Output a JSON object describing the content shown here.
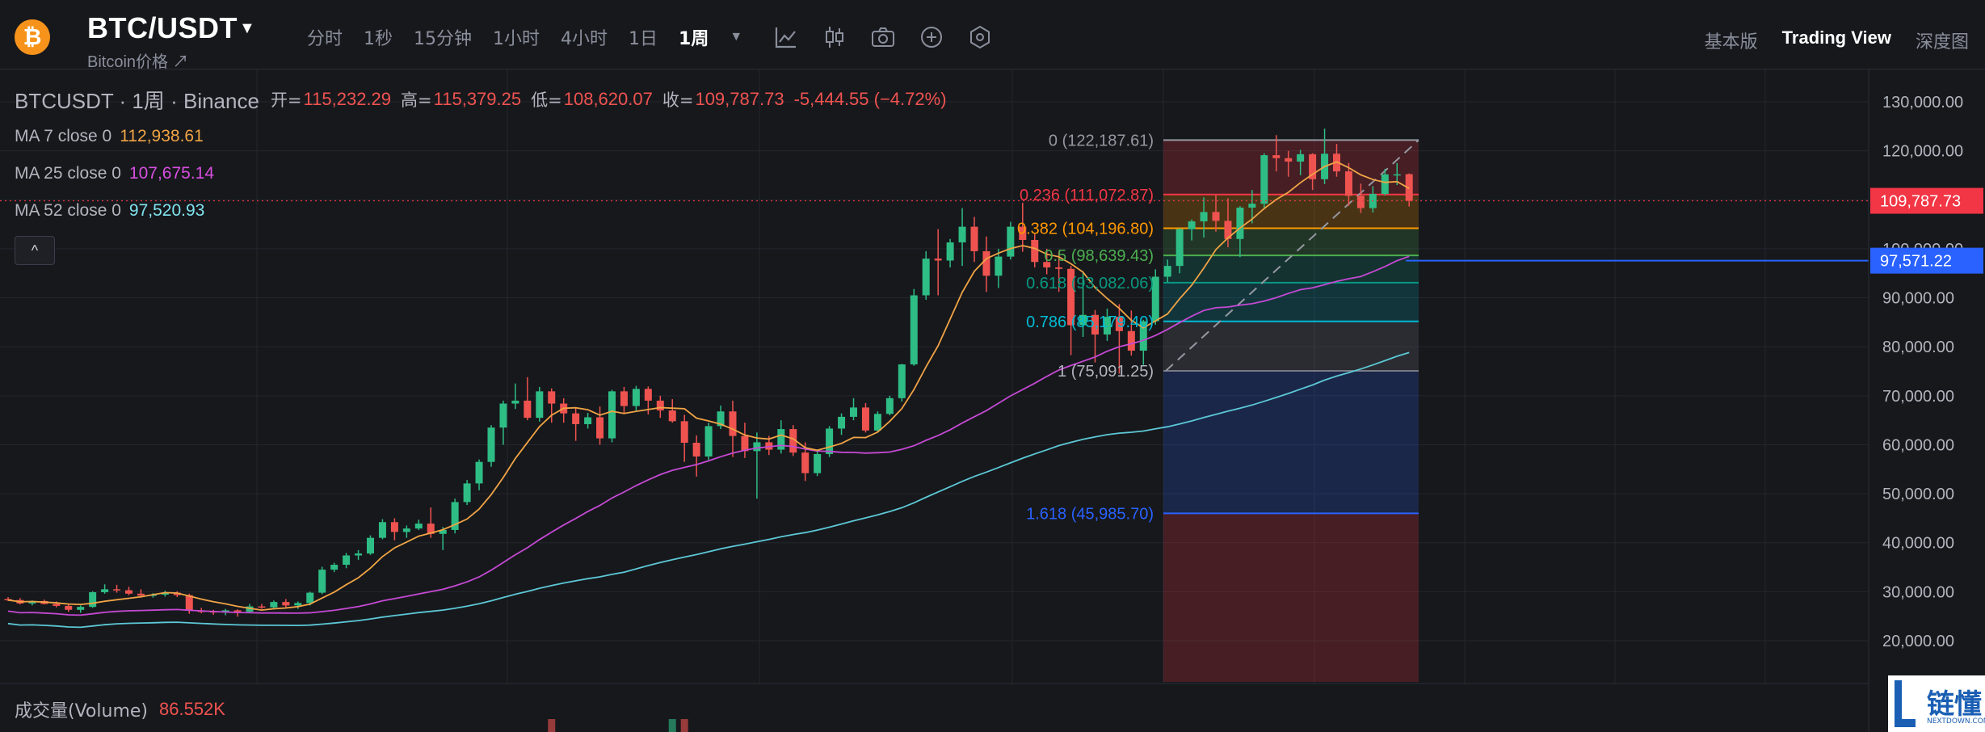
{
  "header": {
    "coin_icon": "bitcoin-icon",
    "coin_symbol_glyph": "₿",
    "pair": "BTC/USDT",
    "subtitle": "Bitcoin价格 ↗",
    "intervals": [
      "分时",
      "1秒",
      "15分钟",
      "1小时",
      "4小时",
      "1日",
      "1周"
    ],
    "active_interval": "1周",
    "tools": [
      "indicator-icon",
      "candle-type-icon",
      "camera-icon",
      "add-icon",
      "settings-icon"
    ],
    "view_tabs": [
      "基本版",
      "Trading View",
      "深度图"
    ],
    "active_view": "Trading View"
  },
  "legend": {
    "symbol": "BTCUSDT · 1周 · Binance",
    "open_label": "开=",
    "open": "115,232.29",
    "high_label": "高=",
    "high": "115,379.25",
    "low_label": "低=",
    "low": "108,620.07",
    "close_label": "收=",
    "close": "109,787.73",
    "change": "-5,444.55 (−4.72%)",
    "ma7_label": "MA 7 close 0",
    "ma7_value": "112,938.61",
    "ma25_label": "MA 25 close 0",
    "ma25_value": "107,675.14",
    "ma52_label": "MA 52 close 0",
    "ma52_value": "97,520.93",
    "collapse_glyph": "^"
  },
  "volume": {
    "label": "成交量(Volume)",
    "value": "86.552K"
  },
  "watermark": {
    "text": "链懂",
    "sub": "NEXTDOWN.COM"
  },
  "colors": {
    "background": "#17181c",
    "up": "#26a69a",
    "up_bright": "#2ebd85",
    "down": "#ef5350",
    "ma7": "#f0a445",
    "ma25": "#c549d4",
    "ma52": "#5cc8d6",
    "price_marker": "#f23645",
    "ma52_marker": "#2962ff"
  },
  "chart_data": {
    "type": "candlestick",
    "timeframe": "1周",
    "y_ticks": [
      "20,000.00",
      "30,000.00",
      "40,000.00",
      "50,000.00",
      "60,000.00",
      "70,000.00",
      "80,000.00",
      "90,000.00",
      "100,000.00",
      "110,000.00",
      "120,000.00",
      "130,000.00"
    ],
    "y_tick_values": [
      20000,
      30000,
      40000,
      50000,
      60000,
      70000,
      80000,
      90000,
      100000,
      110000,
      120000,
      130000
    ],
    "current_price_label": "109,787.73",
    "current_price": 109787.73,
    "ma52_price_label": "97,571.22",
    "ma52_price": 97571.22,
    "fib_levels": [
      {
        "label": "0 (122,187.61)",
        "value": 122187.61,
        "color": "#9598a1"
      },
      {
        "label": "0.236 (111,072.87)",
        "value": 111072.87,
        "color": "#f23645"
      },
      {
        "label": "0.382 (104,196.80)",
        "value": 104196.8,
        "color": "#ff9800"
      },
      {
        "label": "0.5 (98,639.43)",
        "value": 98639.43,
        "color": "#4caf50"
      },
      {
        "label": "0.618 (93,082.06)",
        "value": 93082.06,
        "color": "#089981"
      },
      {
        "label": "0.786 (85,179.40)",
        "value": 85179.4,
        "color": "#00bcd4"
      },
      {
        "label": "1 (75,091.25)",
        "value": 75091.25,
        "color": "#787b86"
      },
      {
        "label": "1.618 (45,985.70)",
        "value": 45985.7,
        "color": "#2962ff"
      }
    ],
    "candles": [
      [
        28500,
        28900,
        28100,
        28300
      ],
      [
        28300,
        28700,
        27400,
        27600
      ],
      [
        27600,
        28200,
        27200,
        28100
      ],
      [
        28100,
        28400,
        27400,
        27500
      ],
      [
        27500,
        28000,
        26800,
        27100
      ],
      [
        27100,
        27500,
        25900,
        26300
      ],
      [
        26300,
        27200,
        25700,
        26900
      ],
      [
        26900,
        30100,
        26700,
        29900
      ],
      [
        29900,
        31500,
        29600,
        30500
      ],
      [
        30500,
        31400,
        29800,
        30300
      ],
      [
        30300,
        31000,
        29300,
        29600
      ],
      [
        29600,
        30500,
        28900,
        29200
      ],
      [
        29200,
        29700,
        28800,
        29400
      ],
      [
        29400,
        30200,
        29000,
        29800
      ],
      [
        29800,
        30100,
        28900,
        29300
      ],
      [
        29300,
        29600,
        25500,
        26100
      ],
      [
        26100,
        26700,
        25600,
        26000
      ],
      [
        26000,
        26300,
        25300,
        25800
      ],
      [
        25800,
        26500,
        25200,
        26200
      ],
      [
        26200,
        26400,
        24900,
        25900
      ],
      [
        25900,
        27500,
        25700,
        27000
      ],
      [
        27000,
        27500,
        26500,
        26800
      ],
      [
        26800,
        28200,
        26600,
        27900
      ],
      [
        27900,
        28500,
        26800,
        27200
      ],
      [
        27200,
        28000,
        26500,
        27700
      ],
      [
        27700,
        30000,
        27200,
        29800
      ],
      [
        29800,
        35100,
        29500,
        34500
      ],
      [
        34500,
        35900,
        34000,
        35500
      ],
      [
        35500,
        37900,
        34800,
        37400
      ],
      [
        37400,
        38500,
        36500,
        37800
      ],
      [
        37800,
        41500,
        37500,
        41000
      ],
      [
        41000,
        44800,
        40700,
        44200
      ],
      [
        44200,
        45000,
        40500,
        42200
      ],
      [
        42200,
        43500,
        41000,
        42900
      ],
      [
        42900,
        44700,
        42600,
        43900
      ],
      [
        43900,
        47200,
        41000,
        41800
      ],
      [
        41800,
        43200,
        38500,
        42600
      ],
      [
        42600,
        49000,
        41900,
        48300
      ],
      [
        48300,
        52800,
        47700,
        52100
      ],
      [
        52100,
        57000,
        50700,
        56500
      ],
      [
        56500,
        64000,
        55500,
        63500
      ],
      [
        63500,
        69000,
        60000,
        68400
      ],
      [
        68400,
        72500,
        67300,
        69000
      ],
      [
        69000,
        73800,
        65000,
        65500
      ],
      [
        65500,
        71800,
        64700,
        70900
      ],
      [
        70900,
        71500,
        64500,
        68400
      ],
      [
        68400,
        69500,
        64500,
        66400
      ],
      [
        66400,
        67500,
        60800,
        64200
      ],
      [
        64200,
        66500,
        63300,
        65600
      ],
      [
        65600,
        67800,
        60000,
        61300
      ],
      [
        61300,
        71200,
        60500,
        70900
      ],
      [
        70900,
        71800,
        66500,
        67900
      ],
      [
        67900,
        72000,
        67000,
        71400
      ],
      [
        71400,
        71900,
        66200,
        69000
      ],
      [
        69000,
        70000,
        65500,
        67000
      ],
      [
        67000,
        69300,
        64500,
        64800
      ],
      [
        64800,
        66100,
        56500,
        60400
      ],
      [
        60400,
        61900,
        53500,
        57600
      ],
      [
        57600,
        64500,
        56800,
        63800
      ],
      [
        63800,
        68000,
        63200,
        66800
      ],
      [
        66800,
        69000,
        57500,
        61800
      ],
      [
        61800,
        64500,
        57300,
        58700
      ],
      [
        58700,
        62500,
        49000,
        60500
      ],
      [
        60500,
        61800,
        57900,
        59000
      ],
      [
        59000,
        65000,
        58200,
        63200
      ],
      [
        63200,
        64000,
        57700,
        58400
      ],
      [
        58400,
        60500,
        52600,
        54200
      ],
      [
        54200,
        58800,
        53600,
        58100
      ],
      [
        58100,
        63800,
        57500,
        63300
      ],
      [
        63300,
        66400,
        62000,
        65700
      ],
      [
        65700,
        69500,
        65000,
        67600
      ],
      [
        67600,
        68500,
        62500,
        62900
      ],
      [
        62900,
        66800,
        62600,
        66300
      ],
      [
        66300,
        70000,
        66000,
        69500
      ],
      [
        69500,
        76500,
        68800,
        76400
      ],
      [
        76400,
        91800,
        76100,
        90500
      ],
      [
        90500,
        99500,
        89600,
        98000
      ],
      [
        98000,
        104000,
        90500,
        97600
      ],
      [
        97600,
        102000,
        96200,
        101300
      ],
      [
        101300,
        108300,
        96500,
        104500
      ],
      [
        104500,
        106500,
        97300,
        99500
      ],
      [
        99500,
        102500,
        91200,
        94500
      ],
      [
        94500,
        100000,
        92000,
        98400
      ],
      [
        98400,
        105500,
        97800,
        104500
      ],
      [
        104500,
        109400,
        99400,
        101800
      ],
      [
        101800,
        103000,
        96200,
        97300
      ],
      [
        97300,
        100000,
        94800,
        96200
      ],
      [
        96200,
        99400,
        91200,
        95900
      ],
      [
        95900,
        96500,
        78300,
        84400
      ],
      [
        84400,
        95000,
        82000,
        86500
      ],
      [
        86500,
        87500,
        76800,
        82500
      ],
      [
        82500,
        87800,
        81200,
        86100
      ],
      [
        86100,
        88700,
        74500,
        83200
      ],
      [
        83200,
        87400,
        78200,
        79200
      ],
      [
        79200,
        85500,
        76300,
        85200
      ],
      [
        85200,
        95800,
        84500,
        94300
      ],
      [
        94300,
        97800,
        93200,
        96500
      ],
      [
        96500,
        104200,
        95000,
        104000
      ],
      [
        104000,
        106000,
        101700,
        105600
      ],
      [
        105600,
        110500,
        102300,
        107500
      ],
      [
        107500,
        111000,
        103500,
        105700
      ],
      [
        105700,
        110300,
        100300,
        102000
      ],
      [
        102000,
        108700,
        98300,
        108400
      ],
      [
        108400,
        112000,
        105200,
        109200
      ],
      [
        109200,
        119500,
        108400,
        119100
      ],
      [
        119100,
        123200,
        115800,
        118500
      ],
      [
        118500,
        120000,
        114700,
        117800
      ],
      [
        117800,
        120200,
        115000,
        119300
      ],
      [
        119300,
        119500,
        112000,
        114200
      ],
      [
        114200,
        124500,
        113200,
        119400
      ],
      [
        119400,
        121400,
        114700,
        115800
      ],
      [
        115800,
        117500,
        108800,
        110800
      ],
      [
        110800,
        113300,
        107300,
        108300
      ],
      [
        108300,
        112800,
        107400,
        111200
      ],
      [
        111200,
        116300,
        110900,
        115200
      ],
      [
        115200,
        117500,
        113000,
        115200
      ],
      [
        115232,
        115379,
        108620,
        109788
      ]
    ],
    "volume_visible": [
      {
        "index": 45,
        "direction": "down"
      },
      {
        "index": 55,
        "direction": "up"
      },
      {
        "index": 56,
        "direction": "down"
      }
    ]
  }
}
